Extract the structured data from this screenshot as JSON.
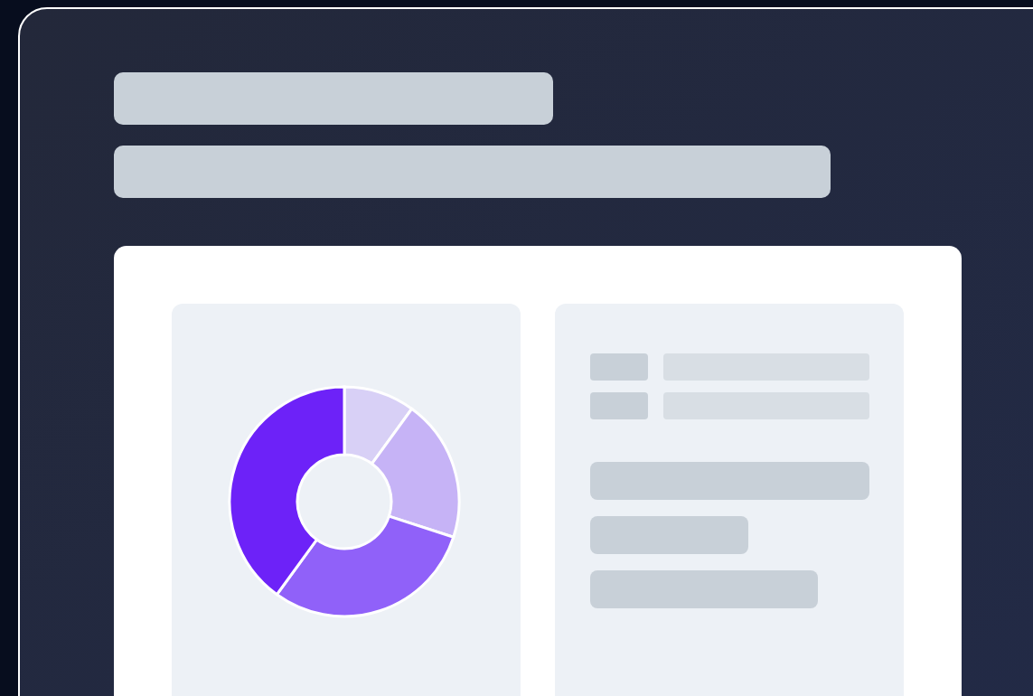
{
  "header": {
    "placeholders": [
      {
        "kind": "medium"
      },
      {
        "kind": "long"
      }
    ]
  },
  "card": {
    "chart_panel": {
      "slices": [
        {
          "color": "#d8d0f6"
        },
        {
          "color": "#c6b3f6"
        },
        {
          "color": "#9061f9"
        },
        {
          "color": "#6d22f8"
        }
      ]
    },
    "detail_panel": {
      "rows": [
        {
          "kind": "pair"
        },
        {
          "kind": "pair"
        },
        {
          "kind": "long"
        },
        {
          "kind": "short"
        },
        {
          "kind": "medium"
        }
      ]
    }
  }
}
